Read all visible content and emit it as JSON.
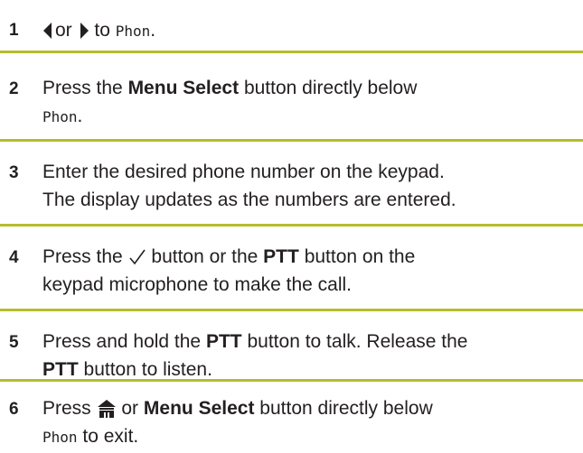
{
  "steps": [
    {
      "number": "1",
      "or_text": "or",
      "to_text": "to",
      "display_text": "Phon",
      "end": "."
    },
    {
      "number": "2",
      "press": "Press the",
      "button_name": "Menu Select",
      "after": "button directly below",
      "display_text": "Phon",
      "end": "."
    },
    {
      "number": "3",
      "line1": "Enter the desired phone number on the keypad.",
      "line2": "The display updates as the numbers are entered."
    },
    {
      "number": "4",
      "press": "Press the",
      "mid": "button or the",
      "button_name": "PTT",
      "after": "button on the",
      "line2": "keypad microphone to make the call."
    },
    {
      "number": "5",
      "press": "Press and hold the",
      "button_name": "PTT",
      "after": "button to talk. Release the",
      "button_name2": "PTT",
      "line2_after": "button to listen."
    },
    {
      "number": "6",
      "press": "Press",
      "or_text": "or",
      "button_name": "Menu Select",
      "after": "button directly below",
      "display_text": "Phon",
      "line2_after": "to exit."
    }
  ],
  "colors": {
    "divider": "#b5bd2a",
    "text": "#231f20"
  },
  "icons": [
    "left-arrow-icon",
    "right-arrow-icon",
    "checkmark-icon",
    "home-icon"
  ]
}
